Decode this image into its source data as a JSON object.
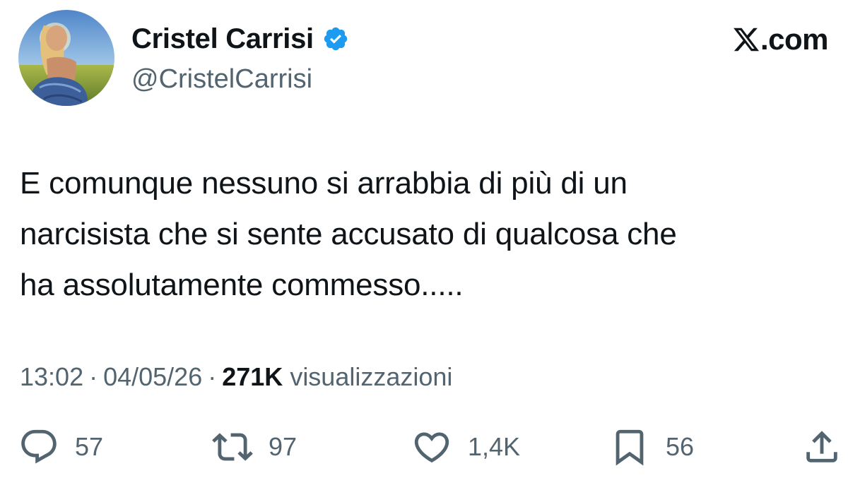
{
  "author": {
    "display_name": "Cristel Carrisi",
    "handle": "@CristelCarrisi",
    "verified_icon": "verified-badge-icon",
    "verified_color": "#1d9bf0"
  },
  "brand": {
    "mark": "x-logo-icon",
    "suffix": ".com"
  },
  "tweet": {
    "lines": [
      "E comunque nessuno si arrabbia di più di un",
      "narcisista che si sente accusato di qualcosa che",
      "ha assolutamente commesso....."
    ]
  },
  "meta": {
    "time": "13:02",
    "date": "04/05/26",
    "separator": "·",
    "views_count": "271K",
    "views_label": "visualizzazioni"
  },
  "actions": {
    "reply": {
      "icon": "reply-icon",
      "count": "57"
    },
    "retweet": {
      "icon": "retweet-icon",
      "count": "97"
    },
    "like": {
      "icon": "heart-icon",
      "count": "1,4K"
    },
    "bookmark": {
      "icon": "bookmark-icon",
      "count": "56"
    },
    "share": {
      "icon": "share-icon"
    }
  },
  "colors": {
    "text_primary": "#0f1419",
    "text_secondary": "#536471",
    "background": "#ffffff"
  }
}
